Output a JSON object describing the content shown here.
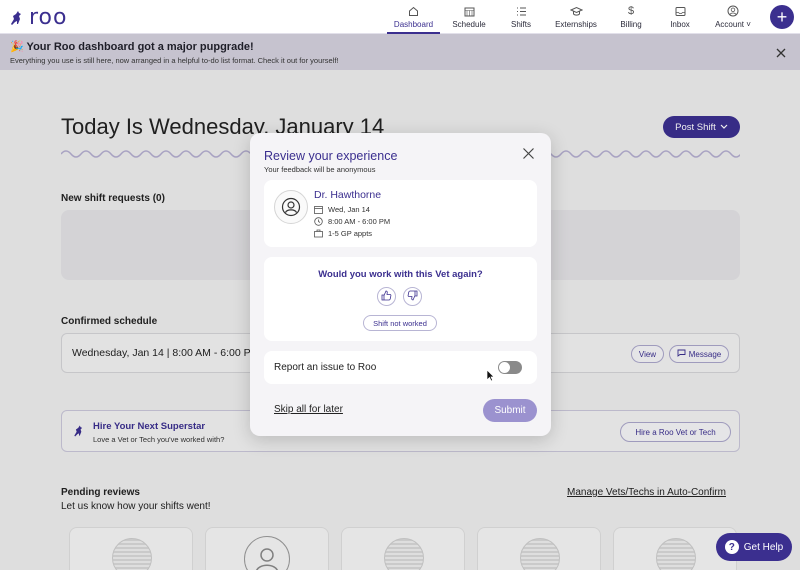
{
  "app": {
    "logo_text": "roo"
  },
  "nav": {
    "items": [
      {
        "label": "Dashboard",
        "icon": "home-icon",
        "active": true
      },
      {
        "label": "Schedule",
        "icon": "calendar-icon"
      },
      {
        "label": "Shifts",
        "icon": "list-icon"
      },
      {
        "label": "Externships",
        "icon": "graduation-cap-icon"
      },
      {
        "label": "Billing",
        "icon": "dollar-icon"
      },
      {
        "label": "Inbox",
        "icon": "inbox-icon"
      },
      {
        "label": "Account",
        "icon": "user-circle-icon"
      }
    ],
    "plus_symbol": "+"
  },
  "banner": {
    "title": "🎉 Your Roo dashboard got a major pupgrade!",
    "subtitle": "Everything you use is still here, now arranged in a helpful to-do list format. Check it out for yourself!"
  },
  "page": {
    "title": "Today Is Wednesday, January 14",
    "post_shift_label": "Post Shift",
    "new_requests_heading": "New shift requests (0)",
    "confirmed_heading": "Confirmed schedule",
    "confirmed_row_text": "Wednesday, Jan 14 | 8:00 AM - 6:00 PM",
    "view_label": "View",
    "message_label": "Message",
    "hire_title": "Hire Your Next Superstar",
    "hire_sub": "Love a Vet or Tech you've worked with?",
    "hire_button": "Hire a Roo Vet or Tech",
    "pending_heading": "Pending reviews",
    "pending_sub": "Let us know how your shifts went!",
    "manage_link": "Manage Vets/Techs in Auto-Confirm",
    "get_help": "Get Help"
  },
  "modal": {
    "title": "Review your experience",
    "subtitle": "Your feedback will be anonymous",
    "vet": {
      "name": "Dr. Hawthorne",
      "date": "Wed, Jan 14",
      "time": "8:00 AM - 6:00 PM",
      "appts": "1-5 GP appts"
    },
    "question": "Would you work with this Vet again?",
    "not_worked_label": "Shift not worked",
    "report_label": "Report an issue to Roo",
    "report_toggle_on": false,
    "skip_label": "Skip all for later",
    "submit_label": "Submit"
  },
  "colors": {
    "brand": "#3b2f8f",
    "submit_disabled": "#9b92cf",
    "banner": "#c6c3cf"
  }
}
